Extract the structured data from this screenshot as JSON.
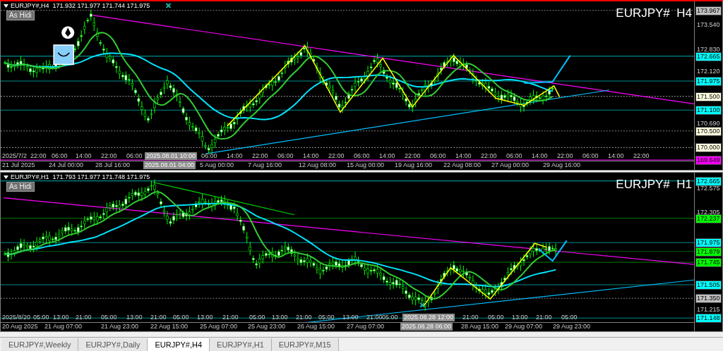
{
  "charts": [
    {
      "active": true,
      "header": "EURJPY#,H4  171.932 171.977 171.744 171.975",
      "button": "As Hidi",
      "title": "EURJPY#  H4",
      "price_labels": [
        {
          "text": "173.967",
          "kind": "badge",
          "color": "#c0c0c0"
        },
        {
          "text": "173.540",
          "kind": "tick"
        },
        {
          "text": "172.830",
          "kind": "tick"
        },
        {
          "text": "172.665",
          "kind": "badge",
          "color": "#00ffff"
        },
        {
          "text": "172.120",
          "kind": "tick"
        },
        {
          "text": "171.975",
          "kind": "badge",
          "color": "#00ffff"
        },
        {
          "text": "171.500",
          "kind": "badge",
          "color": "#ffffe0"
        },
        {
          "text": "171.100",
          "kind": "badge",
          "color": "#00ffff"
        },
        {
          "text": "170.690",
          "kind": "tick"
        },
        {
          "text": "170.500",
          "kind": "badge",
          "color": "#ffffe0"
        },
        {
          "text": "170.000",
          "kind": "badge",
          "color": "#ffffe0"
        },
        {
          "text": "169.649",
          "kind": "badge",
          "color": "#ff00ff"
        }
      ],
      "time_upper": [
        {
          "text": "2025/7/2",
          "kind": "tick"
        },
        {
          "text": "22:00",
          "kind": "tick"
        },
        {
          "text": "06:00",
          "kind": "tick"
        },
        {
          "text": "14:00",
          "kind": "tick"
        },
        {
          "text": "22:00",
          "kind": "tick"
        },
        {
          "text": "06:00",
          "kind": "tick"
        },
        {
          "text": "2025.08.01 10:00",
          "kind": "cursor"
        },
        {
          "text": "06:00",
          "kind": "tick"
        },
        {
          "text": "14:00",
          "kind": "tick"
        },
        {
          "text": "22:00",
          "kind": "tick"
        },
        {
          "text": "06:00",
          "kind": "tick"
        },
        {
          "text": "14:00",
          "kind": "tick"
        },
        {
          "text": "22:00",
          "kind": "tick"
        },
        {
          "text": "06:00",
          "kind": "tick"
        },
        {
          "text": "14:00",
          "kind": "tick"
        },
        {
          "text": "22:00",
          "kind": "tick"
        },
        {
          "text": "06:00",
          "kind": "tick"
        },
        {
          "text": "14:00",
          "kind": "tick"
        },
        {
          "text": "22:00",
          "kind": "tick"
        },
        {
          "text": "06:00",
          "kind": "tick"
        },
        {
          "text": "14:00",
          "kind": "tick"
        },
        {
          "text": "22:00",
          "kind": "tick"
        },
        {
          "text": "06:00",
          "kind": "tick"
        },
        {
          "text": "14:00",
          "kind": "tick"
        },
        {
          "text": "22:00",
          "kind": "tick"
        }
      ],
      "time_lower": [
        {
          "text": "21 Jul 2025",
          "kind": "tick"
        },
        {
          "text": "24 Jul 00:00",
          "kind": "tick"
        },
        {
          "text": "28 Jul 16:00",
          "kind": "tick"
        },
        {
          "text": "2025.08.01 04:00",
          "kind": "cursor"
        },
        {
          "text": "5 Aug 00:00",
          "kind": "tick"
        },
        {
          "text": "7 Aug 16:00",
          "kind": "tick"
        },
        {
          "text": "12 Aug 08:00",
          "kind": "tick"
        },
        {
          "text": "15 Aug 00:00",
          "kind": "tick"
        },
        {
          "text": "19 Aug 16:00",
          "kind": "tick"
        },
        {
          "text": "22 Aug 08:00",
          "kind": "tick"
        },
        {
          "text": "27 Aug 00:00",
          "kind": "tick"
        },
        {
          "text": "29 Aug 16:00",
          "kind": "tick"
        }
      ]
    },
    {
      "active": false,
      "header": "EURJPY#,H1  171.793 171.977 171.748 171.975",
      "button": "As Hidi",
      "title": "EURJPY#  H1",
      "price_labels": [
        {
          "text": "172.665",
          "kind": "badge",
          "color": "#00ffff"
        },
        {
          "text": "172.575",
          "kind": "tick"
        },
        {
          "text": "172.305",
          "kind": "tick"
        },
        {
          "text": "172.237",
          "kind": "badge",
          "color": "#00ff00"
        },
        {
          "text": "171.975",
          "kind": "badge",
          "color": "#00ffff"
        },
        {
          "text": "171.879",
          "kind": "badge",
          "color": "#00ff00"
        },
        {
          "text": "171.745",
          "kind": "badge",
          "color": "#00ff00"
        },
        {
          "text": "171.505",
          "kind": "badge",
          "color": "#00ffff"
        },
        {
          "text": "171.350",
          "kind": "badge",
          "color": "#c0c0c0"
        },
        {
          "text": "171.215",
          "kind": "tick"
        },
        {
          "text": "171.148",
          "kind": "badge",
          "color": "#00ffff"
        }
      ],
      "time_upper": [
        {
          "text": "2025/8/20",
          "kind": "tick"
        },
        {
          "text": "05:00",
          "kind": "tick"
        },
        {
          "text": "13:00",
          "kind": "tick"
        },
        {
          "text": "21:00",
          "kind": "tick"
        },
        {
          "text": "05:00",
          "kind": "tick"
        },
        {
          "text": "13:00",
          "kind": "tick"
        },
        {
          "text": "21:00",
          "kind": "tick"
        },
        {
          "text": "05:00",
          "kind": "tick"
        },
        {
          "text": "13:00",
          "kind": "tick"
        },
        {
          "text": "21:00",
          "kind": "tick"
        },
        {
          "text": "05:00",
          "kind": "tick"
        },
        {
          "text": "13:00",
          "kind": "tick"
        },
        {
          "text": "21:00",
          "kind": "tick"
        },
        {
          "text": "05:00",
          "kind": "tick"
        },
        {
          "text": "13:00",
          "kind": "tick"
        },
        {
          "text": "21:00",
          "kind": "tick"
        },
        {
          "text": "05:00",
          "kind": "tick"
        },
        {
          "text": "2025.08.28 12:00",
          "kind": "cursor"
        },
        {
          "text": "21:00",
          "kind": "tick"
        },
        {
          "text": "05:00",
          "kind": "tick"
        },
        {
          "text": "13:00",
          "kind": "tick"
        },
        {
          "text": "21:00",
          "kind": "tick"
        },
        {
          "text": "05:00",
          "kind": "tick"
        }
      ],
      "time_lower": [
        {
          "text": "20 Aug 2025",
          "kind": "tick"
        },
        {
          "text": "21 Aug 07:00",
          "kind": "tick"
        },
        {
          "text": "21 Aug 23:00",
          "kind": "tick"
        },
        {
          "text": "22 Aug 15:00",
          "kind": "tick"
        },
        {
          "text": "25 Aug 07:00",
          "kind": "tick"
        },
        {
          "text": "25 Aug 23:00",
          "kind": "tick"
        },
        {
          "text": "26 Aug 15:00",
          "kind": "tick"
        },
        {
          "text": "27 Aug 07:00",
          "kind": "tick"
        },
        {
          "text": "2025.08.28 06:00",
          "kind": "cursor"
        },
        {
          "text": "28 Aug 15:00",
          "kind": "tick"
        },
        {
          "text": "29 Aug 07:00",
          "kind": "tick"
        },
        {
          "text": "29 Aug 23:00",
          "kind": "tick"
        }
      ]
    }
  ],
  "tabs": [
    {
      "label": "EURJPY#,Weekly",
      "selected": false
    },
    {
      "label": "EURJPY#,Daily",
      "selected": false
    },
    {
      "label": "EURJPY#,H4",
      "selected": true
    },
    {
      "label": "EURJPY#,H1",
      "selected": false
    },
    {
      "label": "EURJPY#,M15",
      "selected": false
    }
  ]
}
